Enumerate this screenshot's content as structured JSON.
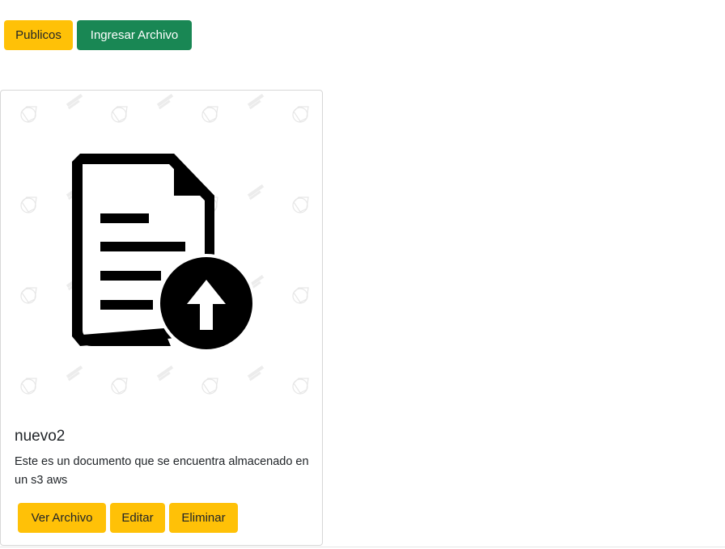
{
  "toolbar": {
    "publicos_label": "Publicos",
    "ingresar_label": "Ingresar Archivo"
  },
  "card": {
    "title": "nuevo2",
    "description": "Este es un documento que se encuentra almacenado en un s3 aws",
    "image_icon": "document-upload-icon",
    "actions": {
      "ver": "Ver Archivo",
      "editar": "Editar",
      "eliminar": "Eliminar"
    }
  },
  "colors": {
    "warning": "#ffc107",
    "success": "#198754"
  }
}
